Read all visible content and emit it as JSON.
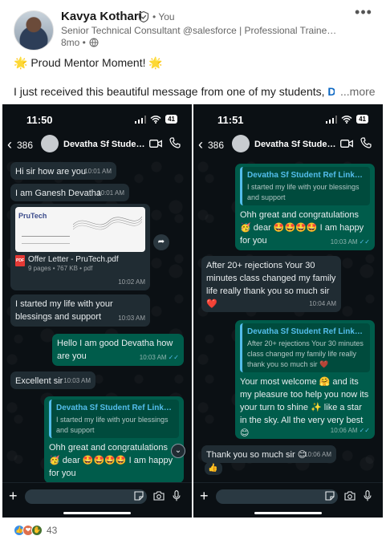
{
  "post": {
    "author": "Kavya Kothari",
    "you_label": "• You",
    "headline": "Senior Technical Consultant @salesforce | Professional Trainer & Me...",
    "time": "8mo •",
    "line1": "🌟 Proud Mentor Moment! 🌟",
    "line2_prefix": "I just received this beautiful message from one of my students, ",
    "line2_mention": "Devatha",
    "see_more": "...more",
    "more_icon": "•••",
    "reaction_count": "43"
  },
  "left_phone": {
    "clock": "11:50",
    "battery": "41",
    "back_count": "386",
    "chat_name": "Devatha Sf Student Ref Linkdin",
    "messages": [
      {
        "text": "Hi sir how are you",
        "time": "10:01 AM"
      },
      {
        "text": "I am Ganesh Devatha",
        "time": "10:01 AM"
      },
      {
        "doc_logo": "PruTech",
        "doc_name": "Offer Letter - PruTech.pdf",
        "doc_info": "9 pages • 767 KB • pdf",
        "time": "10:02 AM"
      },
      {
        "text": "I started my life with your blessings and support",
        "time": "10:03 AM"
      },
      {
        "text": "Hello I am good Devatha how are you",
        "time": "10:03 AM"
      },
      {
        "text": "Excellent sir",
        "time": "10:03 AM"
      },
      {
        "quote_title": "Devatha Sf Student Ref Linkdin Po...",
        "quote_text": "I started my life with your blessings and support",
        "text": "Ohh great and congratulations 🥳 dear 🤩🤩🤩🤩 I am happy for you"
      }
    ]
  },
  "right_phone": {
    "clock": "11:51",
    "battery": "41",
    "back_count": "386",
    "chat_name": "Devatha Sf Student Ref Linkdin",
    "messages": [
      {
        "quote_title": "Devatha Sf Student Ref Linkdin Po...",
        "quote_text": "I started my life with your blessings and support",
        "text": "Ohh great and congratulations 🥳 dear 🤩🤩🤩🤩 I am happy for you",
        "time": "10:03 AM"
      },
      {
        "text": "After 20+ rejections Your 30 minutes class changed my family life really thank you so much sir ❤️",
        "time": "10:04 AM"
      },
      {
        "quote_title": "Devatha Sf Student Ref Linkdin Po...",
        "quote_text": "After 20+ rejections Your 30 minutes class changed my family life really thank you so much sir ❤️",
        "text": "Your most welcome 🤗 and its my pleasure too help you now its your turn to shine ✨ like a star in the sky. All the very very best 😊",
        "time": "10:06 AM"
      },
      {
        "text": "Thank you so much sir 😊",
        "time": "10:06 AM"
      },
      {
        "reaction": "👍"
      }
    ]
  }
}
